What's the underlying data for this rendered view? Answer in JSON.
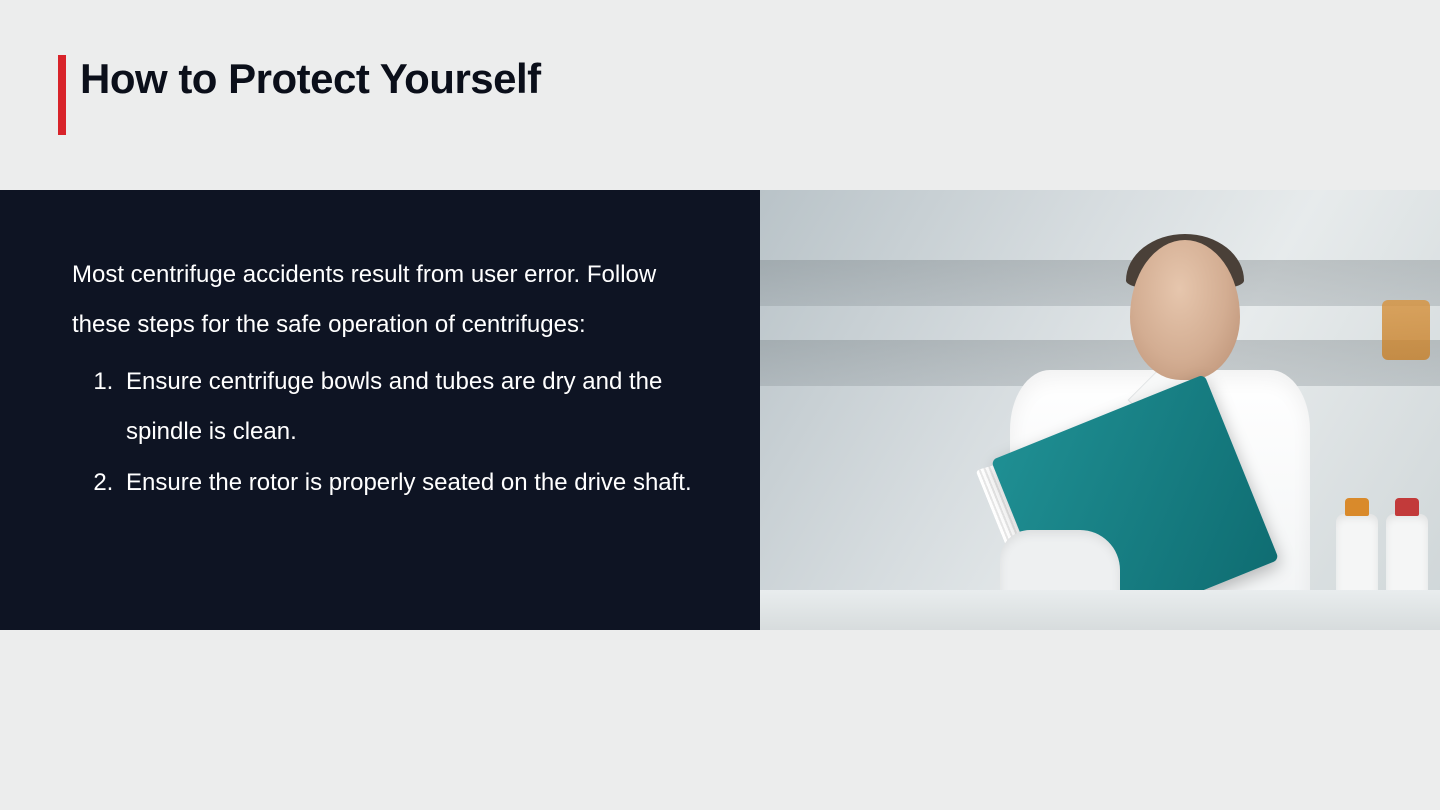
{
  "colors": {
    "accent": "#d8232a",
    "band_bg": "#0e1423",
    "page_bg": "#eceded",
    "text_dark": "#0b0f1a",
    "text_light": "#ffffff"
  },
  "title": "How to Protect Yourself",
  "intro": "Most centrifuge accidents result from user error. Follow these steps for the safe operation of centrifuges:",
  "steps": [
    "Ensure centrifuge bowls and tubes are dry and the spindle is clean.",
    "Ensure the rotor is properly seated on the drive shaft."
  ],
  "image_alt": "Scientist in a white lab coat and gloves reading a teal binder in a laboratory"
}
